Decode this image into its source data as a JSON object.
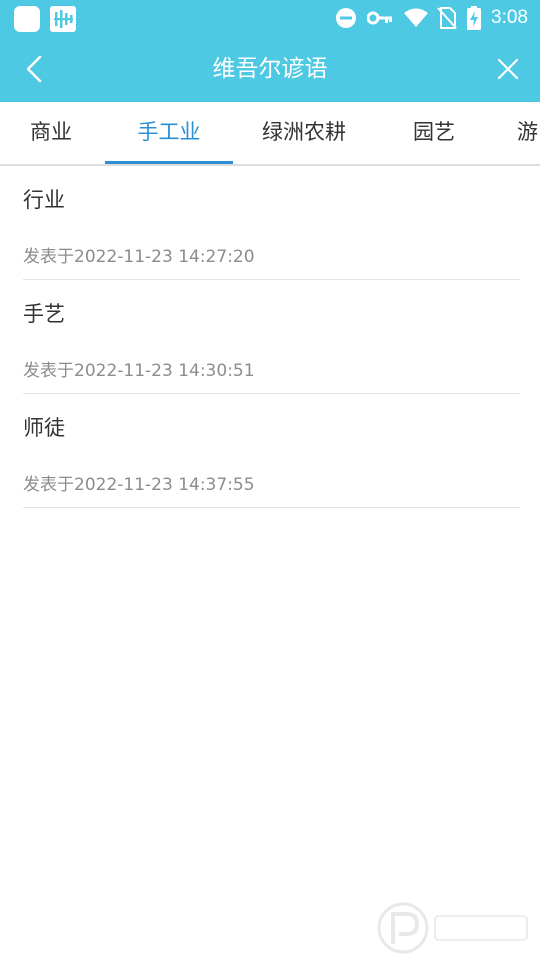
{
  "status_bar": {
    "time": "3:08",
    "icons": [
      "app-icon",
      "app-bars-icon",
      "do-not-disturb-icon",
      "key-icon",
      "wifi-icon",
      "no-sim-icon",
      "battery-charging-icon"
    ]
  },
  "header": {
    "title": "维吾尔谚语",
    "back_icon": "back-chevron-icon",
    "close_icon": "close-icon",
    "color": "#4ec9e3"
  },
  "tabs": [
    {
      "label": "商业"
    },
    {
      "label": "手工业",
      "active": true
    },
    {
      "label": "绿洲农耕"
    },
    {
      "label": "园艺"
    },
    {
      "label": "游"
    }
  ],
  "accent_color": "#2a8fd4",
  "list": [
    {
      "title": "行业",
      "date": "发表于2022-11-23 14:27:20"
    },
    {
      "title": "手艺",
      "date": "发表于2022-11-23 14:30:51"
    },
    {
      "title": "师徒",
      "date": "发表于2022-11-23 14:37:55"
    }
  ]
}
